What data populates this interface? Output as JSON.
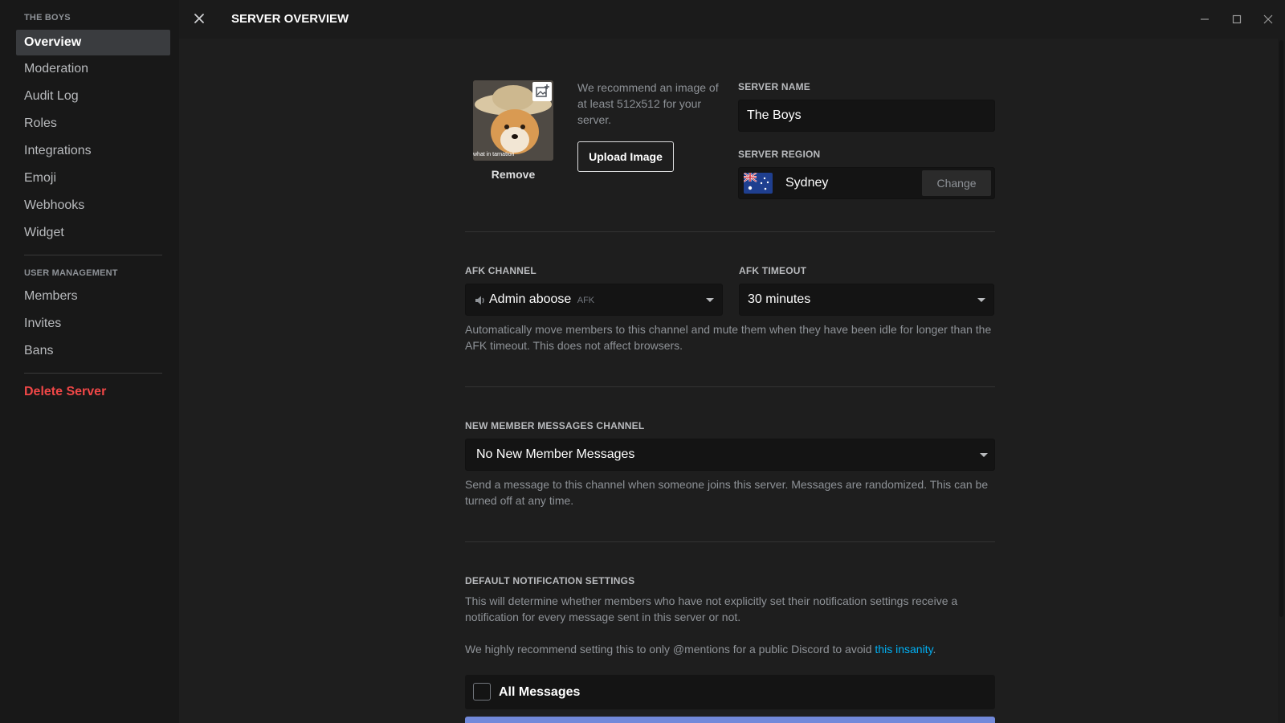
{
  "sidebar": {
    "server_header": "THE BOYS",
    "items": [
      {
        "label": "Overview"
      },
      {
        "label": "Moderation"
      },
      {
        "label": "Audit Log"
      },
      {
        "label": "Roles"
      },
      {
        "label": "Integrations"
      },
      {
        "label": "Emoji"
      },
      {
        "label": "Webhooks"
      },
      {
        "label": "Widget"
      }
    ],
    "user_mgmt_header": "USER MANAGEMENT",
    "user_items": [
      {
        "label": "Members"
      },
      {
        "label": "Invites"
      },
      {
        "label": "Bans"
      }
    ],
    "delete_label": "Delete Server"
  },
  "header": {
    "title": "SERVER OVERVIEW"
  },
  "icon_section": {
    "image_caption": "what in tarnation",
    "remove_label": "Remove",
    "recommend_text": "We recommend an image of at least 512x512 for your server.",
    "upload_label": "Upload Image"
  },
  "server_name": {
    "label": "SERVER NAME",
    "value": "The Boys"
  },
  "server_region": {
    "label": "SERVER REGION",
    "value": "Sydney",
    "change_label": "Change"
  },
  "afk": {
    "channel_label": "AFK CHANNEL",
    "channel_value": "Admin aboose",
    "channel_tag": "AFK",
    "timeout_label": "AFK TIMEOUT",
    "timeout_value": "30 minutes",
    "hint": "Automatically move members to this channel and mute them when they have been idle for longer than the AFK timeout. This does not affect browsers."
  },
  "new_member": {
    "label": "NEW MEMBER MESSAGES CHANNEL",
    "value": "No New Member Messages",
    "hint": "Send a message to this channel when someone joins this server. Messages are randomized. This can be turned off at any time."
  },
  "notifications": {
    "label": "DEFAULT NOTIFICATION SETTINGS",
    "hint": "This will determine whether members who have not explicitly set their notification settings receive a notification for every message sent in this server or not.",
    "recommend_prefix": "We highly recommend setting this to only @mentions for a public Discord to avoid ",
    "recommend_link": "this insanity",
    "recommend_suffix": ".",
    "option_all": "All Messages"
  },
  "colors": {
    "accent": "#7289da",
    "danger": "#f04747",
    "link": "#00b0f4"
  }
}
